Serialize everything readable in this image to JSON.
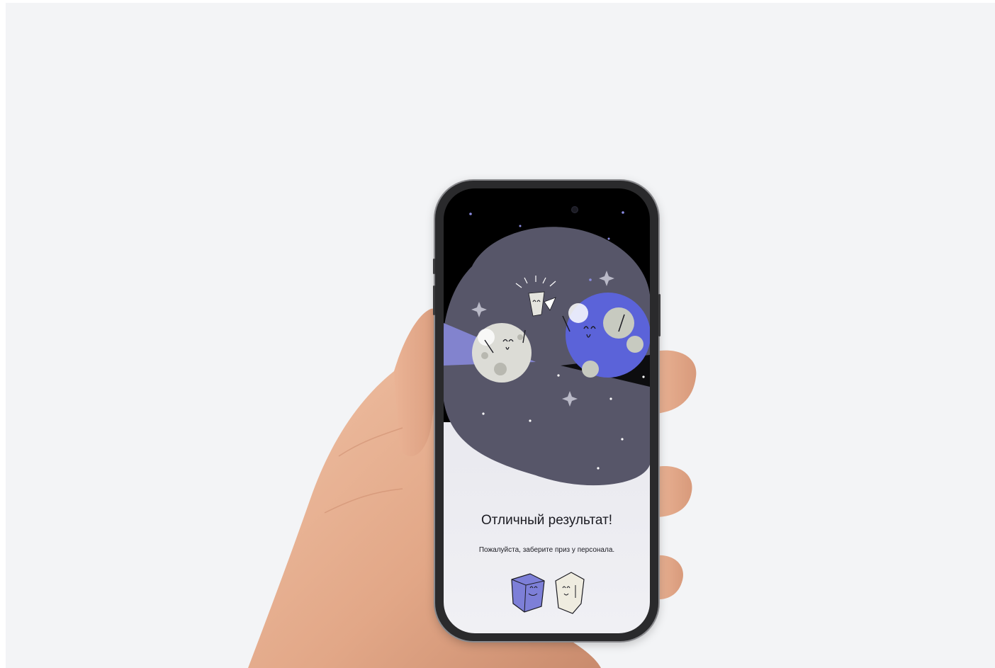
{
  "screen": {
    "headline": "Отличный результат!",
    "subline": "Пожалуйста, заберите приз у персонала."
  },
  "illustration": {
    "characters": [
      "moon-character-icon",
      "earth-character-icon",
      "cup-character-icon",
      "cube-mascot-icon",
      "paper-mascot-icon"
    ]
  },
  "colors": {
    "stage_bg": "#f3f4f6",
    "screen_bg": "#000000",
    "space_blob": "#575669",
    "accent_purple": "#5b63d9",
    "light_purple": "#8a8be0",
    "screen_bottom": "#ebebf0"
  }
}
